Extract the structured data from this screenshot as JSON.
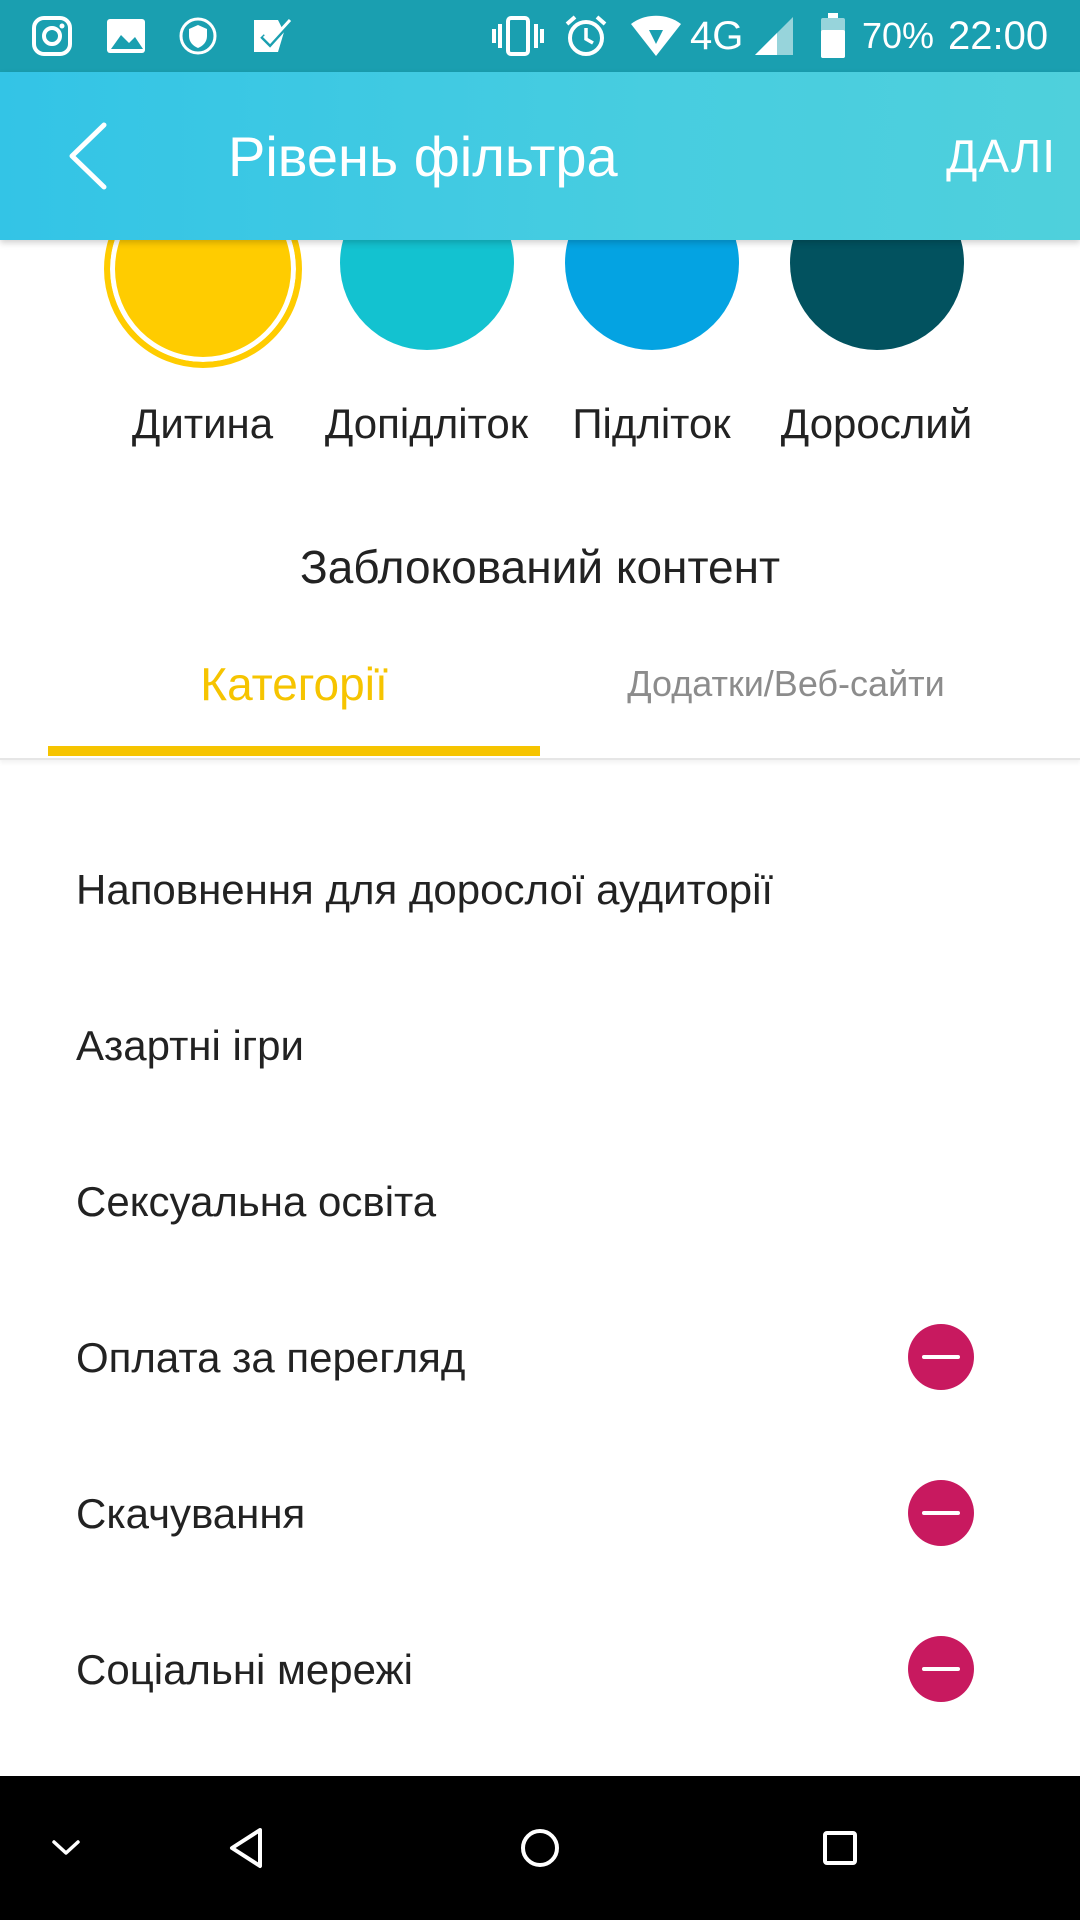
{
  "status_bar": {
    "network": "4G",
    "battery": "70%",
    "time": "22:00",
    "left_icons": [
      "instagram-icon",
      "gallery-icon",
      "shield-vpn-icon",
      "task-check-icon"
    ],
    "right_icons": [
      "vibrate-icon",
      "alarm-icon",
      "wifi-icon",
      "signal-icon",
      "battery-icon"
    ]
  },
  "app_bar": {
    "title": "Рівень фільтра",
    "next_label": "ДАЛІ",
    "back_icon": "chevron-left-icon"
  },
  "levels": {
    "selected_index": 0,
    "items": [
      {
        "label": "Дитина",
        "color": "#ffcc00"
      },
      {
        "label": "Допідліток",
        "color": "#13c2d0"
      },
      {
        "label": "Підліток",
        "color": "#04a3e2"
      },
      {
        "label": "Дорослий",
        "color": "#02525f"
      }
    ]
  },
  "blocked_content": {
    "title": "Заблокований контент"
  },
  "tabs": {
    "active_index": 0,
    "items": [
      {
        "label": "Категорії"
      },
      {
        "label": "Додатки/Веб-сайти"
      }
    ]
  },
  "categories": [
    {
      "label": "Наповнення для дорослої аудиторії",
      "removable": false
    },
    {
      "label": "Азартні ігри",
      "removable": false
    },
    {
      "label": "Сексуальна освіта",
      "removable": false
    },
    {
      "label": "Оплата за перегляд",
      "removable": true
    },
    {
      "label": "Скачування",
      "removable": true
    },
    {
      "label": "Соціальні мережі",
      "removable": true
    }
  ],
  "colors": {
    "accent": "#f6c400",
    "remove": "#c8195f",
    "app_bar": "#40c9e2",
    "status_bar": "#1a9fb0"
  },
  "nav_bar": {
    "icons": [
      "chevron-down-icon",
      "back-triangle-icon",
      "home-circle-icon",
      "recents-square-icon"
    ]
  }
}
